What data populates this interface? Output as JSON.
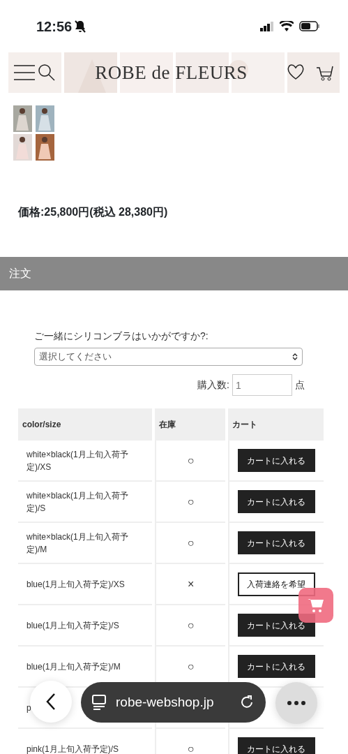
{
  "status_bar": {
    "time": "12:56",
    "silent": true
  },
  "header": {
    "logo": "ROBE de FLEURS"
  },
  "price": "価格:25,800円(税込 28,380円)",
  "section_title": "注文",
  "option": {
    "label": "ご一緒にシリコンブラはいかがですか?:",
    "placeholder": "選択してください"
  },
  "quantity": {
    "label": "購入数:",
    "value": "1",
    "unit": "点"
  },
  "table": {
    "columns": [
      "color/size",
      "在庫",
      "カート"
    ],
    "rows": [
      {
        "kind": "cart",
        "variant": "white×black(1月上旬入荷予定)/XS",
        "stock": "○",
        "action": "カートに入れる"
      },
      {
        "kind": "cart",
        "variant": "white×black(1月上旬入荷予定)/S",
        "stock": "○",
        "action": "カートに入れる"
      },
      {
        "kind": "cart",
        "variant": "white×black(1月上旬入荷予定)/M",
        "stock": "○",
        "action": "カートに入れる"
      },
      {
        "kind": "notify",
        "variant": "blue(1月上旬入荷予定)/XS",
        "stock": "×",
        "action": "入荷連絡を希望"
      },
      {
        "kind": "cart",
        "variant": "blue(1月上旬入荷予定)/S",
        "stock": "○",
        "action": "カートに入れる"
      },
      {
        "kind": "cart",
        "variant": "blue(1月上旬入荷予定)/M",
        "stock": "○",
        "action": "カートに入れる"
      },
      {
        "kind": "obscured",
        "variant": "p"
      },
      {
        "kind": "cart",
        "variant": "pink(1月上旬入荷予定)/S",
        "stock": "○",
        "action": "カートに入れる"
      }
    ]
  },
  "browser_bar": {
    "url": "robe-webshop.jp"
  }
}
